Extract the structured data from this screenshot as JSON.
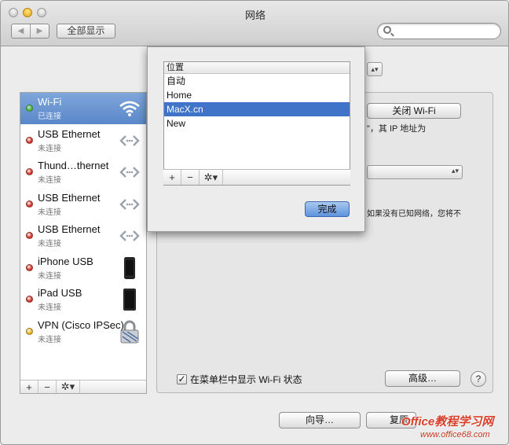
{
  "window": {
    "title": "网络",
    "show_all_label": "全部显示",
    "search_placeholder": "",
    "nav_back": "◀",
    "nav_forward": "▶"
  },
  "location_popup_arrow": "▴▾",
  "services": [
    {
      "name": "Wi-Fi",
      "status": "已连接",
      "dot_color": "#4fbd3a",
      "icon": "wifi-icon",
      "selected": true
    },
    {
      "name": "USB Ethernet",
      "status": "未连接",
      "dot_color": "#d33a2c",
      "icon": "ethernet-icon"
    },
    {
      "name": "Thund…thernet",
      "status": "未连接",
      "dot_color": "#d33a2c",
      "icon": "ethernet-icon"
    },
    {
      "name": "USB Ethernet",
      "status": "未连接",
      "dot_color": "#d33a2c",
      "icon": "ethernet-icon"
    },
    {
      "name": "USB Ethernet",
      "status": "未连接",
      "dot_color": "#d33a2c",
      "icon": "ethernet-icon"
    },
    {
      "name": "iPhone USB",
      "status": "未连接",
      "dot_color": "#d33a2c",
      "icon": "iphone-icon"
    },
    {
      "name": "iPad USB",
      "status": "未连接",
      "dot_color": "#d33a2c",
      "icon": "ipad-icon"
    },
    {
      "name": "VPN (Cisco IPSec)",
      "status": "未连接",
      "dot_color": "#e8b21f",
      "icon": "lock-icon"
    }
  ],
  "sidebar_tools": {
    "add": "+",
    "remove": "−",
    "gear": "✲▾"
  },
  "main": {
    "turn_off_wifi": "关闭 Wi-Fi",
    "ip_text": "\"，其 IP 地址为",
    "network_name_arrow": "▴▾",
    "ask_text": "如果没有已知网络，您将不",
    "show_status_label": "在菜单栏中显示 Wi-Fi 状态",
    "show_status_checked": "✓",
    "advanced": "高级…",
    "help": "?",
    "assist": "向导…",
    "revert": "复原"
  },
  "locations_sheet": {
    "header": "位置",
    "items": [
      "自动",
      "Home",
      "MacX.cn",
      "New"
    ],
    "selected_index": 2,
    "tools": {
      "add": "+",
      "remove": "−",
      "gear": "✲▾"
    },
    "done": "完成"
  },
  "watermark": {
    "line1": "Office教程学习网",
    "line2": "www.office68.com"
  }
}
